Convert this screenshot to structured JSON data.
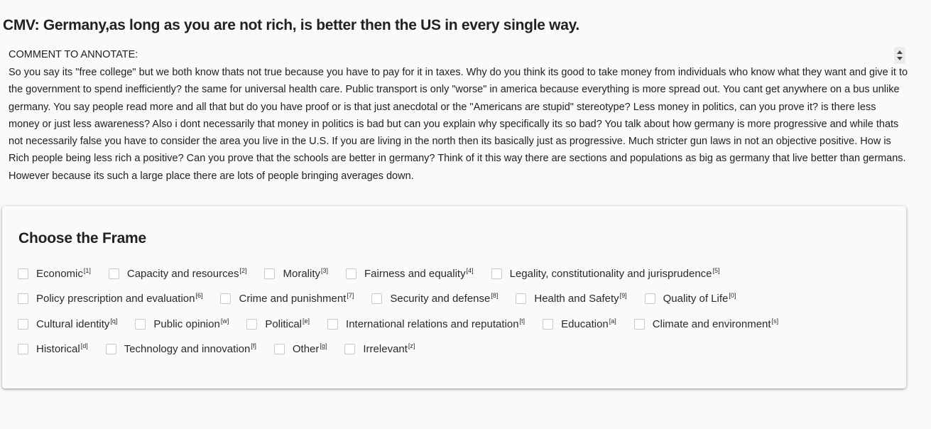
{
  "page": {
    "title": "CMV: Germany,as long as you are not rich, is better then the US in every single way."
  },
  "comment": {
    "label": "COMMENT TO ANNOTATE:",
    "text": "So you say its \"free college\" but we both know thats not true because you have to pay for it in taxes. Why do you think its good to take money from individuals who know what they want and give it to the government to spend inefficiently? the same for universal health care. Public transport is only \"worse\" in america because everything is more spread out. You cant get anywhere on a bus unlike germany. You say people read more and all that but do you have proof or is that just anecdotal or the \"Americans are stupid\" stereotype? Less money in politics, can you prove it? is there less money or just less awareness? Also i dont necessarily that money in politics is bad but can you explain why specifically its so bad? You talk about how germany is more progressive and while thats not necessarily false you have to consider the area you live in the U.S. If you are living in the north then its basically just as progressive. Much stricter gun laws in not an objective positive. How is Rich people being less rich a positive? Can you prove that the schools are better in germany? Think of it this way there are sections and populations as big as germany that live better than germans. However because its such a large place there are lots of people bringing averages down."
  },
  "frames": {
    "title": "Choose the Frame",
    "rows": [
      [
        {
          "label": "Economic",
          "key": "[1]"
        },
        {
          "label": "Capacity and resources",
          "key": "[2]"
        },
        {
          "label": "Morality",
          "key": "[3]"
        },
        {
          "label": "Fairness and equality",
          "key": "[4]"
        },
        {
          "label": "Legality, constitutionality and jurisprudence",
          "key": "[5]"
        }
      ],
      [
        {
          "label": "Policy prescription and evaluation",
          "key": "[6]"
        },
        {
          "label": "Crime and punishment",
          "key": "[7]"
        },
        {
          "label": "Security and defense",
          "key": "[8]"
        },
        {
          "label": "Health and Safety",
          "key": "[9]"
        },
        {
          "label": "Quality of Life",
          "key": "[0]"
        }
      ],
      [
        {
          "label": "Cultural identity",
          "key": "[q]"
        },
        {
          "label": "Public opinion",
          "key": "[w]"
        },
        {
          "label": "Political",
          "key": "[e]"
        },
        {
          "label": "International relations and reputation",
          "key": "[t]"
        },
        {
          "label": "Education",
          "key": "[a]"
        },
        {
          "label": "Climate and environment",
          "key": "[s]"
        }
      ],
      [
        {
          "label": "Historical",
          "key": "[d]"
        },
        {
          "label": "Technology and innovation",
          "key": "[f]"
        },
        {
          "label": "Other",
          "key": "[g]"
        },
        {
          "label": "Irrelevant",
          "key": "[z]"
        }
      ]
    ]
  }
}
